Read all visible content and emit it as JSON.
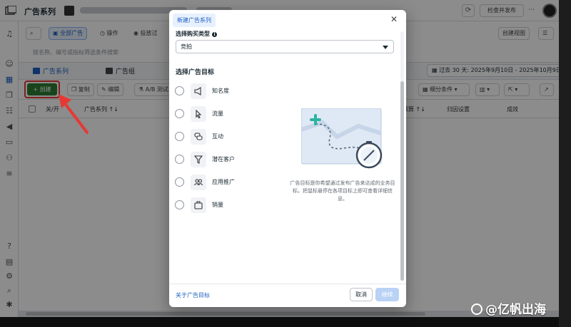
{
  "header": {
    "title": "广告系列",
    "review_button": "检查并发布"
  },
  "toolbar": {
    "all_ads_label": "全部广告",
    "activity_label": "操作",
    "delivered_label": "投放过",
    "create_view_label": "创建视图",
    "search_placeholder": "按名称、编号或指标筛选条件搜索"
  },
  "tabs": {
    "campaigns": "广告系列",
    "adsets": "广告组",
    "date_range": "过去 30 天: 2025年9月10日 - 2025年10月9日"
  },
  "actions": {
    "create": "+ 创建",
    "copy": "复制",
    "edit": "编辑",
    "ab_test": "A/B 测试",
    "breakdown": "细分条件"
  },
  "table": {
    "columns": [
      "关/开",
      "广告系列 ↑↓",
      "预算 ↑↓",
      "归因设置",
      "成效"
    ]
  },
  "modal": {
    "title": "新建广告系列",
    "buy_type_label": "选择购买类型",
    "buy_type_value": "竞拍",
    "objective_heading": "选择广告目标",
    "objectives": [
      {
        "label": "知名度",
        "icon": "megaphone-icon"
      },
      {
        "label": "流量",
        "icon": "cursor-icon"
      },
      {
        "label": "互动",
        "icon": "chat-bubbles-icon"
      },
      {
        "label": "潜在客户",
        "icon": "funnel-icon"
      },
      {
        "label": "应用推广",
        "icon": "people-icon"
      },
      {
        "label": "销量",
        "icon": "briefcase-icon"
      }
    ],
    "description": "广告目标是你希望通过发布广告来达成的业务目标。把鼠标悬停在各项目标上即可查看详细信息。",
    "footer_link": "关于广告目标",
    "cancel": "取消",
    "continue": "继续"
  },
  "watermark": "@亿帆出海",
  "colors": {
    "accent": "#1b5fc1",
    "create_green": "#2e7d32",
    "highlight_red": "#e53935"
  }
}
